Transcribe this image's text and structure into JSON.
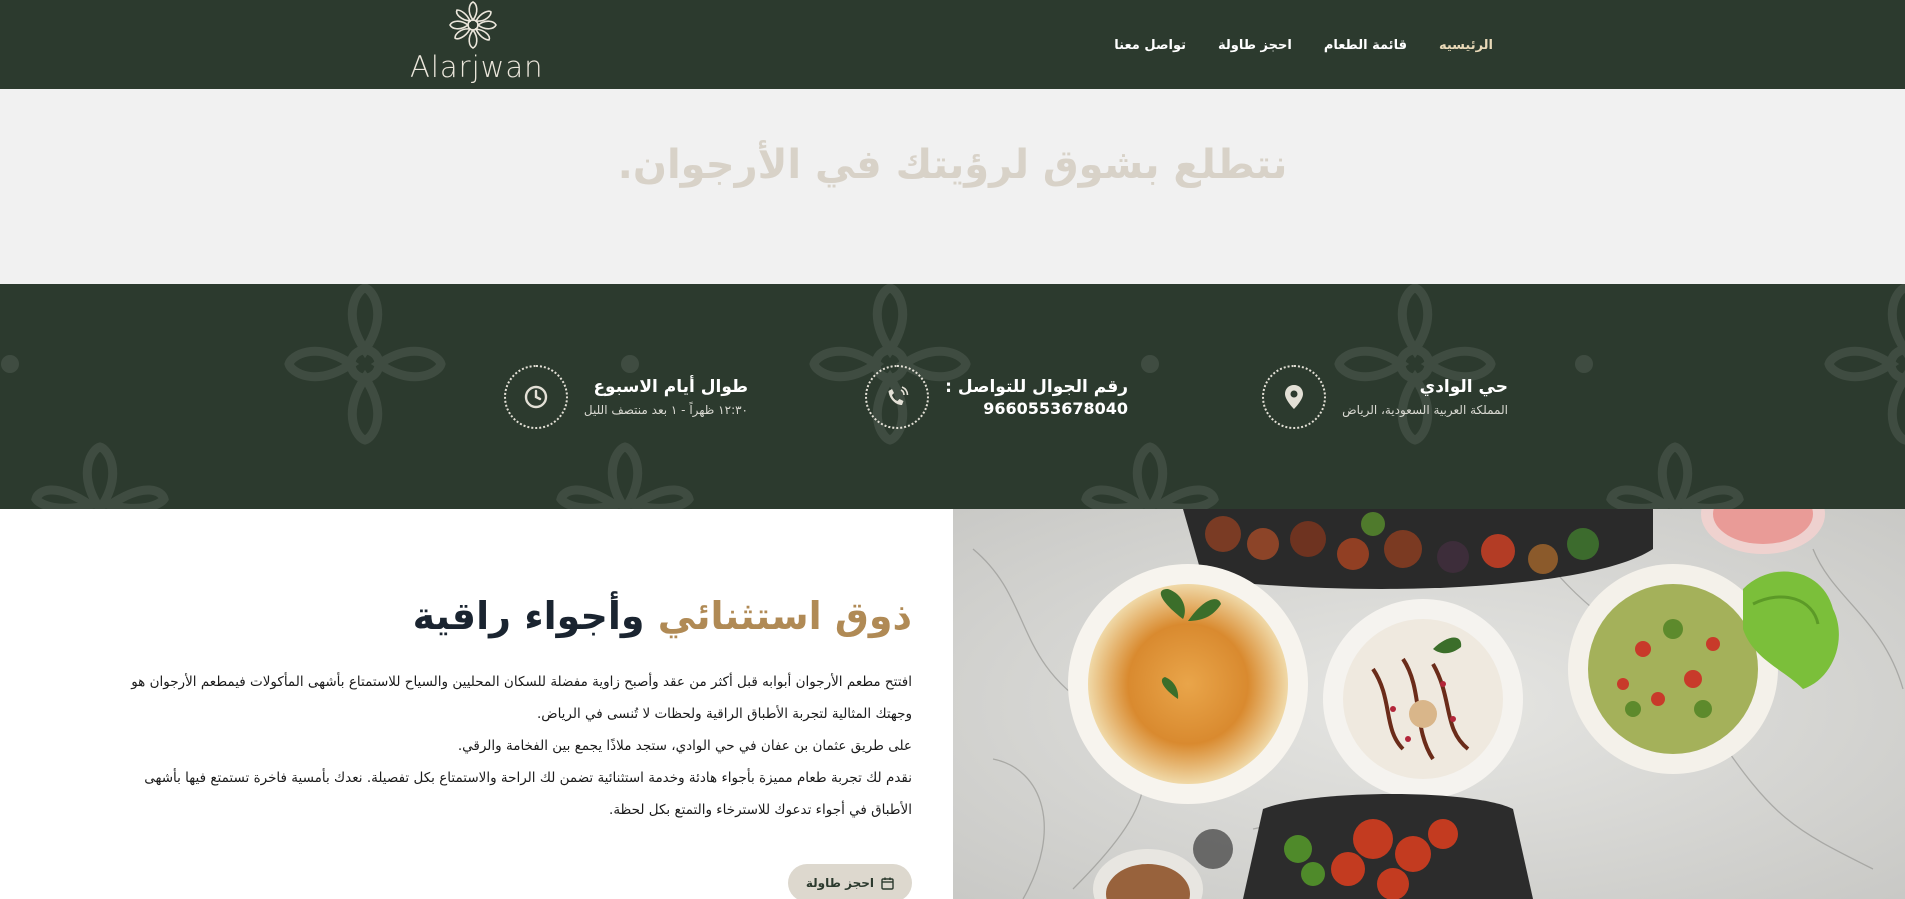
{
  "header": {
    "logo_text": "Alarjwan",
    "nav": [
      {
        "label": "الرئيسيه",
        "active": true
      },
      {
        "label": "قائمة الطعام",
        "active": false
      },
      {
        "label": "احجز طاولة",
        "active": false
      },
      {
        "label": "تواصل معنا",
        "active": false
      }
    ]
  },
  "tagline": "نتطلع بشوق لرؤيتك في الأرجوان.",
  "info": {
    "location": {
      "icon": "location-pin-icon",
      "title": "حي الوادي",
      "subtitle": "المملكة العربية السعودية، الرياض"
    },
    "phone": {
      "icon": "phone-icon",
      "title": "رقم الجوال للتواصل :",
      "number": "9660553678040"
    },
    "hours": {
      "icon": "clock-icon",
      "title": "طوال أيام الاسبوع",
      "subtitle": "١٢:٣٠ ظهراً - ١ بعد منتصف الليل"
    }
  },
  "about": {
    "heading_accent": "ذوق استثنائي",
    "heading_rest": "وأجواء راقية",
    "paragraph_lines": [
      "افتتح مطعم الأرجوان أبوابه قبل أكثر من عقد وأصبح زاوية مفضلة للسكان المحليين والسياح للاستمتاع بأشهى المأكولات فيمطعم الأرجوان هو",
      "وجهتك المثالية لتجربة الأطباق الراقية ولحظات لا تُنسى في الرياض.",
      "على طريق عثمان بن عفان في حي الوادي، ستجد ملاذًا يجمع بين الفخامة والرقي.",
      "نقدم لك تجربة طعام مميزة بأجواء هادئة وخدمة استثنائية تضمن لك الراحة والاستمتاع بكل تفصيلة. نعدك بأمسية فاخرة تستمتع فيها بأشهى",
      "الأطباق في أجواء تدعوك للاسترخاء والتمتع بكل لحظة."
    ],
    "button_label": "احجز طاولة"
  },
  "colors": {
    "brand_dark_green": "#2c3a2e",
    "accent_gold": "#b08a55",
    "tagline_beige": "#d8d2c8"
  }
}
